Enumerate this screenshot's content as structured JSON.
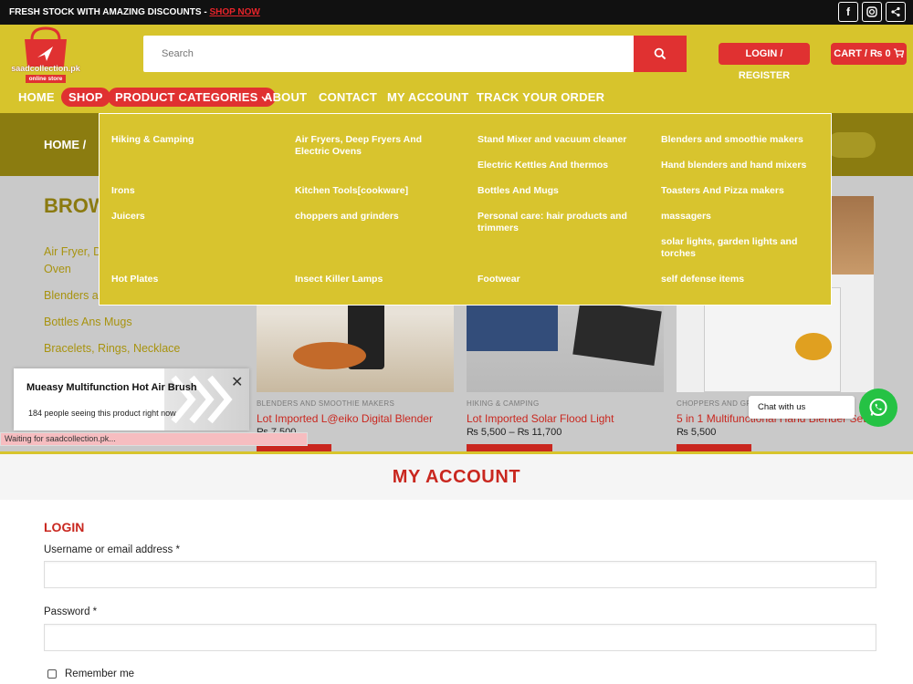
{
  "topbar": {
    "promo_text": "FRESH STOCK WITH AMAZING DISCOUNTS - ",
    "promo_link": "SHOP NOW",
    "social": [
      "facebook-icon",
      "instagram-icon",
      "share-icon"
    ]
  },
  "header": {
    "logo_name": "saadcollection.pk",
    "logo_tagline": "online store",
    "search_placeholder": "Search",
    "login_label": "LOGIN / REGISTER",
    "cart_label": "CART / ₨ 0"
  },
  "nav": {
    "home": "HOME",
    "shop": "SHOP",
    "categories": "PRODUCT CATEGORIES",
    "about": "ABOUT",
    "contact": "CONTACT",
    "account": "MY ACCOUNT",
    "track": "TRACK YOUR ORDER"
  },
  "mega_menu": [
    "Hiking & Camping",
    "Air Fryers, Deep Fryers And Electric Ovens",
    "Stand Mixer and vacuum cleaner",
    "Blenders and smoothie makers",
    "Electric Kettles And thermos",
    "Hand blenders and hand mixers",
    "Irons",
    "Kitchen Tools[cookware]",
    "Bottles And Mugs",
    "Toasters And Pizza makers",
    "Juicers",
    "choppers and grinders",
    "Personal care: hair products and trimmers",
    "massagers",
    "solar lights, garden lights and torches",
    "Hot Plates",
    "Insect Killer Lamps",
    "Footwear",
    "self defense items"
  ],
  "breadcrumb": "HOME  /",
  "browse": {
    "heading": "BROW",
    "items": [
      "Air Fryer, D",
      "Oven",
      "Blenders a",
      "Bottles Ans Mugs",
      "Bracelets, Rings, Necklace"
    ]
  },
  "products": [
    {
      "category": "BLENDERS AND SMOOTHIE MAKERS",
      "title": "Lot Imported L@eiko Digital Blender",
      "price": "₨ 7,500"
    },
    {
      "category": "HIKING & CAMPING",
      "title": "Lot Imported Solar Flood Light",
      "price": "₨ 5,500 – ₨ 11,700"
    },
    {
      "category": "CHOPPERS AND GR",
      "title": "5 in 1 Multifunctional Hand Blender Set",
      "price": "₨ 5,500"
    }
  ],
  "popup": {
    "title": "Mueasy Multifunction Hot Air Brush",
    "subtitle": "184 people seeing this product right now"
  },
  "status_text": "Waiting for saadcollection.pk...",
  "chat_label": "Chat with us",
  "account": {
    "title": "MY ACCOUNT",
    "login_heading": "LOGIN",
    "username_label": "Username or email address *",
    "password_label": "Password *",
    "remember_label": "Remember me"
  },
  "colors": {
    "accent": "#e03131",
    "brand": "#d7c42c",
    "hero": "#8b7c10"
  }
}
